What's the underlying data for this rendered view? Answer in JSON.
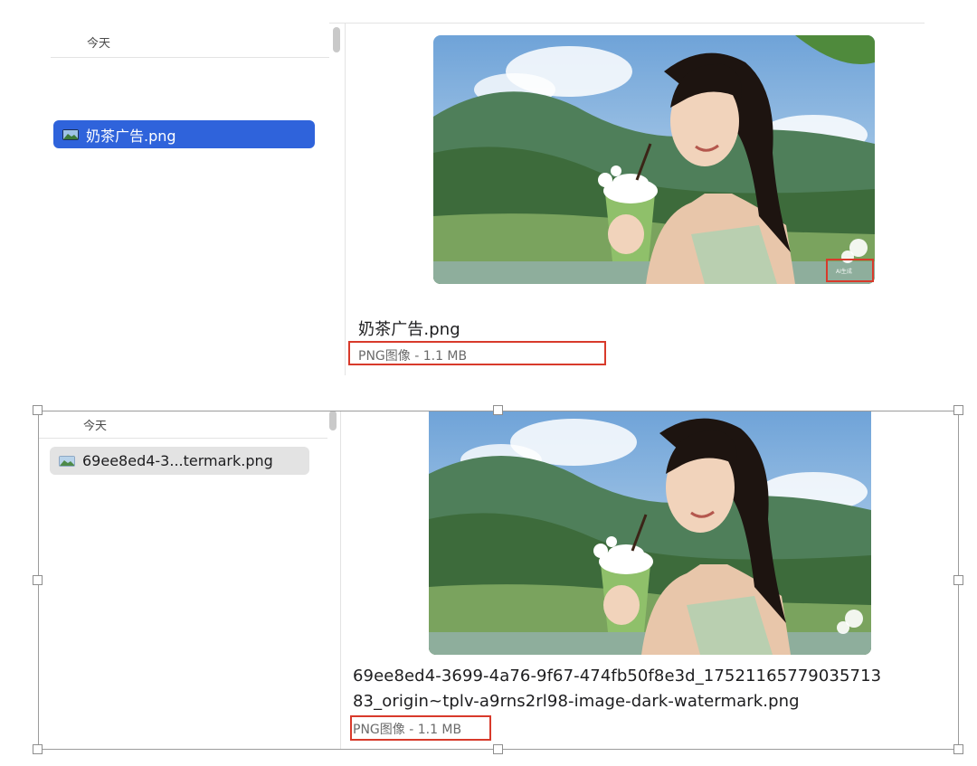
{
  "top_window": {
    "section_header": "今天",
    "file_row_label": "奶茶广告.png",
    "file_title": "奶茶广告.png",
    "file_meta": "PNG图像 - 1.1 MB",
    "watermark_label": "AI生成"
  },
  "bottom_window": {
    "section_header": "今天",
    "file_row_label": "69ee8ed4-3...termark.png",
    "file_title_line1": "69ee8ed4-3699-4a76-9f67-474fb50f8e3d_17521165779035713",
    "file_title_line2": "83_origin~tplv-a9rns2rl98-image-dark-watermark.png",
    "file_meta": "PNG图像 - 1.1 MB"
  },
  "colors": {
    "selection_blue": "#2f63db",
    "highlight_red": "#d83a2b",
    "inactive_row": "#e3e3e3"
  },
  "icons": [
    "image-file-icon",
    "scroll-thumb",
    "resize-handle"
  ]
}
